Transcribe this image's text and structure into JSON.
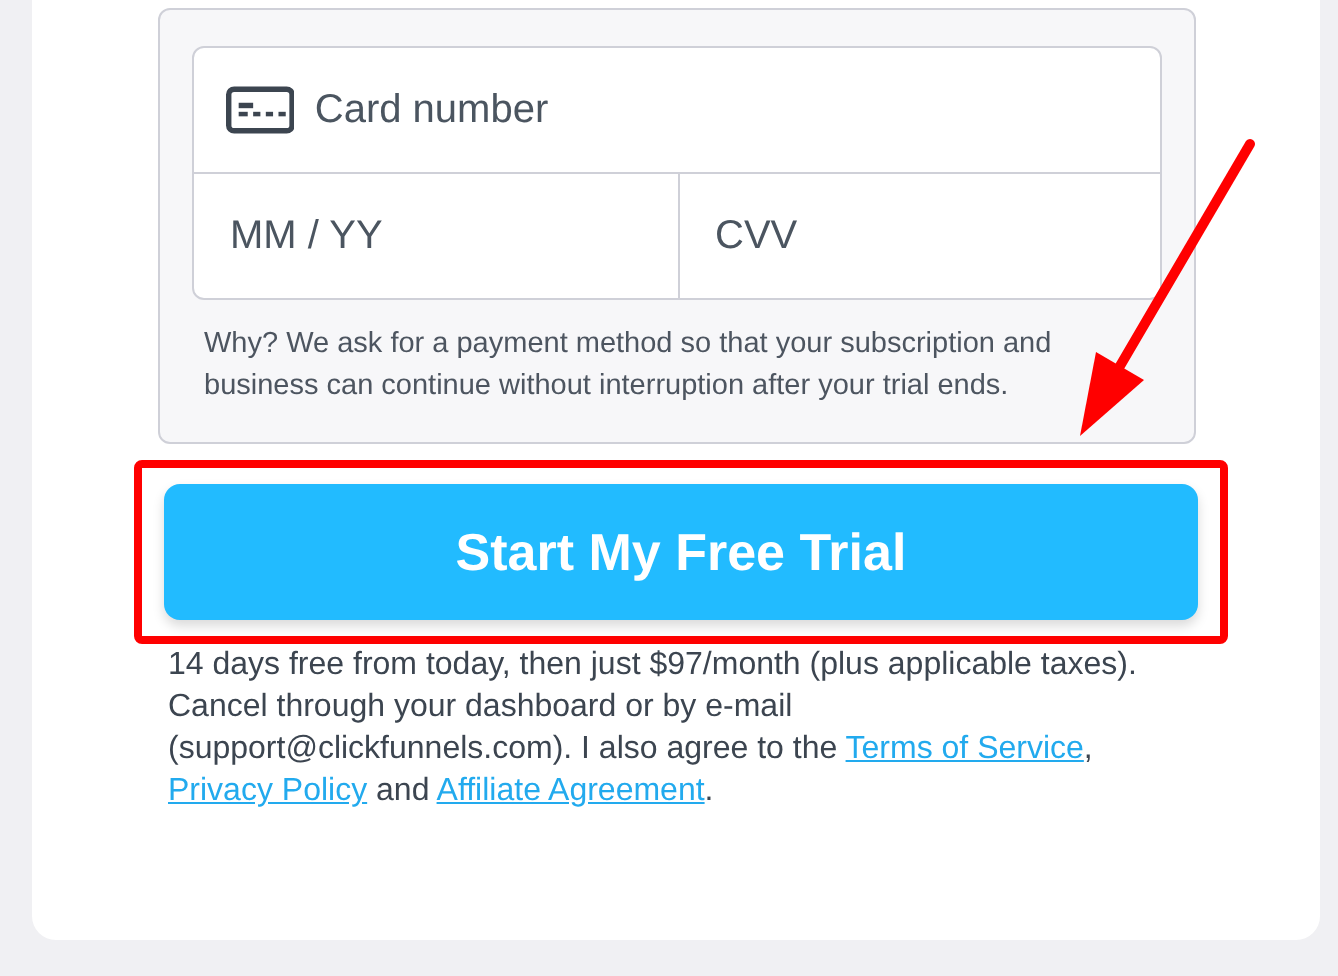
{
  "payment_form": {
    "card_number": {
      "placeholder": "Card number"
    },
    "expiry": {
      "placeholder": "MM / YY"
    },
    "cvv": {
      "placeholder": "CVV"
    },
    "note": "Why? We ask for a payment method so that your subscription and business can continue without interruption after your trial ends."
  },
  "submit_button": {
    "label": "Start My Free Trial",
    "highlighted": true
  },
  "terms": [
    {
      "kind": "text",
      "text": "14 days free from today, then just $97/month (plus applicable taxes). Cancel through your dashboard or by e-mail (support@clickfunnels.com). I also agree to the "
    },
    {
      "kind": "link",
      "text": "Terms of Service"
    },
    {
      "kind": "text",
      "text": ", "
    },
    {
      "kind": "link",
      "text": "Privacy Policy"
    },
    {
      "kind": "text",
      "text": " and "
    },
    {
      "kind": "link",
      "text": "Affiliate Agreement"
    },
    {
      "kind": "text",
      "text": "."
    }
  ]
}
